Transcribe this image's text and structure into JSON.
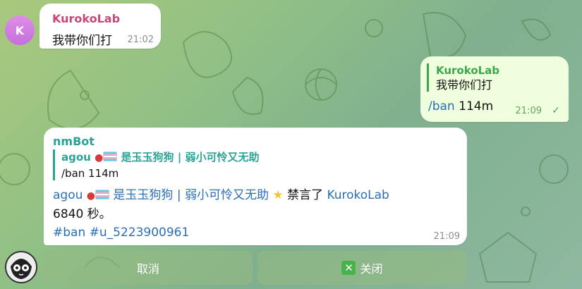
{
  "messages": [
    {
      "sender": "KurokoLab",
      "avatar_letter": "K",
      "text": "我带你们打",
      "time": "21:02"
    },
    {
      "reply_to_sender": "KurokoLab",
      "reply_to_text": "我带你们打",
      "command": "/ban",
      "argument": "114m",
      "time": "21:09"
    },
    {
      "sender": "nmBot",
      "reply_to_sender_name": "agou",
      "reply_to_sender_suffix": "是玉玉狗狗 | 弱小可怜又无助",
      "reply_to_text": "/ban 114m",
      "body_name": "agou",
      "body_suffix": "是玉玉狗狗 | 弱小可怜又无助",
      "body_action": "禁言了",
      "body_target": "KurokoLab",
      "body_duration": "6840 秒。",
      "hashtag_ban": "#ban",
      "hashtag_user": "#u_5223900961",
      "time": "21:09"
    }
  ],
  "keyboard": {
    "cancel_label": "取消",
    "close_label": "关闭"
  },
  "colors": {
    "sender_kurokolab": "#c9457a",
    "sender_bot": "#2aa397",
    "link": "#2a6fb7",
    "outgoing_bubble": "#effedd"
  },
  "icons": [
    "read-check-icon",
    "close-x-icon",
    "strawberry-emoji",
    "trans-flag-emoji",
    "star-emoji"
  ]
}
